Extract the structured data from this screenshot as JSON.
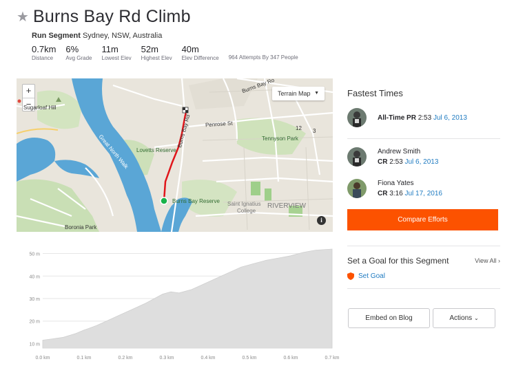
{
  "segment": {
    "title": "Burns Bay Rd Climb",
    "type": "Run Segment",
    "location": "Sydney, NSW, Australia",
    "stats": [
      {
        "value": "0.7km",
        "label": "Distance"
      },
      {
        "value": "6%",
        "label": "Avg Grade"
      },
      {
        "value": "11m",
        "label": "Lowest Elev"
      },
      {
        "value": "52m",
        "label": "Highest Elev"
      },
      {
        "value": "40m",
        "label": "Elev Difference"
      }
    ],
    "attempts": "964 Attempts By 347 People"
  },
  "map": {
    "zoom_in": "+",
    "zoom_out": "−",
    "terrain_label": "Terrain Map",
    "info": "i",
    "labels": {
      "sugarloaf_hill": "Sugarloaf Hill",
      "burns_bay_ro": "Burns Bay Ro",
      "burns_bay_rd": "Burns Bay Rd",
      "penrose_st": "Penrose St",
      "tennyson_park": "Tennyson Park",
      "lovetts_reserve": "Lovetts Reserve",
      "great_north_walk": "Great North Walk",
      "burns_bay_reserve": "Burns Bay Reserve",
      "saint_ignatius": "Saint Ignatius",
      "college": "College",
      "riverview": "RIVERVIEW",
      "boronia_park": "Boronia Park",
      "num_12": "12",
      "num_3": "3"
    }
  },
  "fastest_times": {
    "title": "Fastest Times",
    "entries": [
      {
        "name": "",
        "label": "All-Time PR",
        "time": "2:53",
        "date": "Jul 6, 2013"
      },
      {
        "name": "Andrew Smith",
        "label": "CR",
        "time": "2:53",
        "date": "Jul 6, 2013"
      },
      {
        "name": "Fiona Yates",
        "label": "CR",
        "time": "3:16",
        "date": "Jul 17, 2016"
      }
    ],
    "compare_label": "Compare Efforts"
  },
  "goal": {
    "title": "Set a Goal for this Segment",
    "view_all": "View All",
    "set_goal": "Set Goal"
  },
  "actions": {
    "embed": "Embed on Blog",
    "actions": "Actions"
  },
  "colors": {
    "accent": "#fc5200",
    "link": "#1f7bc1",
    "route": "#e0161b"
  },
  "chart_data": {
    "type": "area",
    "title": "",
    "xlabel": "",
    "ylabel": "",
    "x_ticks": [
      "0.0 km",
      "0.1 km",
      "0.2 km",
      "0.3 km",
      "0.4 km",
      "0.5 km",
      "0.6 km",
      "0.7 km"
    ],
    "y_ticks": [
      "10 m",
      "20 m",
      "30 m",
      "40 m",
      "50 m"
    ],
    "xlim": [
      0,
      0.7
    ],
    "ylim": [
      8,
      52
    ],
    "x": [
      0,
      0.02,
      0.05,
      0.08,
      0.1,
      0.13,
      0.16,
      0.19,
      0.22,
      0.25,
      0.27,
      0.29,
      0.31,
      0.33,
      0.36,
      0.39,
      0.42,
      0.45,
      0.48,
      0.51,
      0.54,
      0.57,
      0.6,
      0.63,
      0.66,
      0.7
    ],
    "y": [
      11.5,
      12,
      12.8,
      14.5,
      16,
      18,
      20.5,
      23,
      25.5,
      28,
      30,
      32,
      33,
      32.5,
      34,
      36.5,
      39,
      41.5,
      44,
      45.5,
      47,
      48,
      49,
      50.5,
      51.5,
      52
    ]
  }
}
